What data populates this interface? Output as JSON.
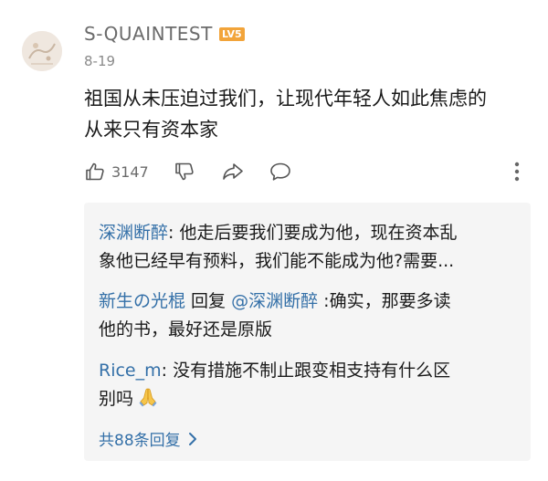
{
  "comment": {
    "username": "S-QUAINTEST",
    "level_badge": "LV5",
    "date": "8-19",
    "text_line1": "祖国从未压迫过我们，让现代年轻人如此焦虑的",
    "text_line2": "从来只有资本家",
    "like_count": "3147"
  },
  "replies": [
    {
      "author": "深渊断醉",
      "separator": ": ",
      "line1_text": "他走后要我们要成为他，现在资本乱",
      "line2_text": "象他已经早有预料，我们能不能成为他?需要..."
    },
    {
      "author": "新生の光棍",
      "reply_word": " 回复 ",
      "mention": "@深渊断醉",
      "line1_text": " :确实，那要多读",
      "line2_text": "他的书，最好还是原版"
    },
    {
      "author": "Rice_m",
      "separator": ": ",
      "line1_text": "没有措施不制止跟变相支持有什么区",
      "line2_text": "别吗",
      "emoji": "folded-hands"
    }
  ],
  "more_replies_label": "共88条回复",
  "colors": {
    "link_blue": "#3470a8",
    "badge_orange": "#f2a43a",
    "reply_bg": "#f5f5f5",
    "meta_gray": "#8a8a8a"
  },
  "icons": [
    "thumbs-up-icon",
    "thumbs-down-icon",
    "share-icon",
    "comment-icon",
    "more-vertical-icon",
    "chevron-right-icon"
  ]
}
